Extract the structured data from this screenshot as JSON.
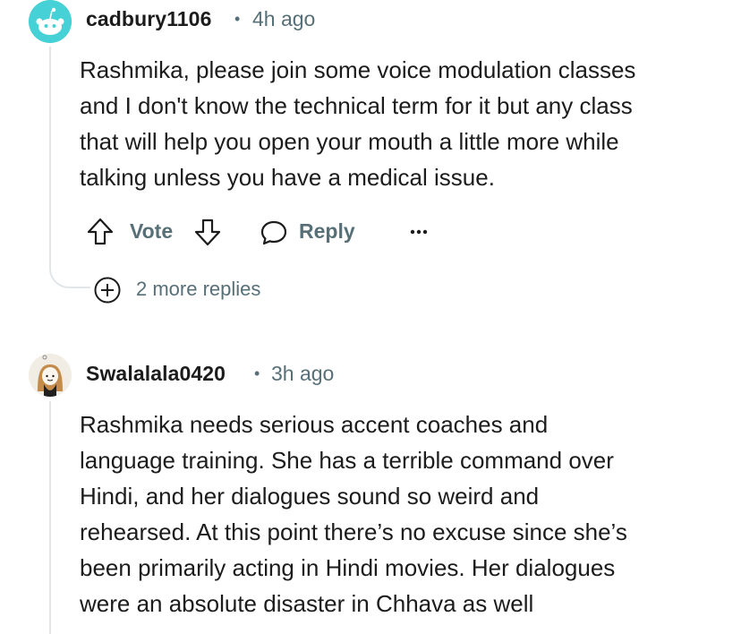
{
  "comments": [
    {
      "username": "cadbury1106",
      "separator": "•",
      "time": "4h ago",
      "lines": [
        "Rashmika, please join some voice modulation classes",
        "and I don't know the technical term for it but any class",
        "that will help you open your mouth a little more while",
        "talking unless you have a medical issue."
      ],
      "actions": {
        "vote_label": "Vote",
        "reply_label": "Reply",
        "more_label": "•••"
      },
      "more_replies_label": "2 more replies"
    },
    {
      "username": "Swalalala0420",
      "separator": "•",
      "time": "3h ago",
      "lines": [
        "Rashmika needs serious accent coaches and",
        "language training. She has a terrible command over",
        "Hindi, and her dialogues sound so weird and",
        "rehearsed. At this point there’s no excuse since she’s",
        "been primarily acting in Hindi movies. Her dialogues",
        "were an absolute disaster in Chhava as well"
      ]
    }
  ],
  "colors": {
    "avatar1_bg": "#46d1d6",
    "meta_gray": "#576f76",
    "thread_line": "#e3e6e8"
  },
  "icons": {
    "upvote": "arrow-up-icon",
    "downvote": "arrow-down-icon",
    "reply": "speech-bubble-icon",
    "more": "overflow-dots-icon",
    "expand": "plus-circle-icon"
  }
}
